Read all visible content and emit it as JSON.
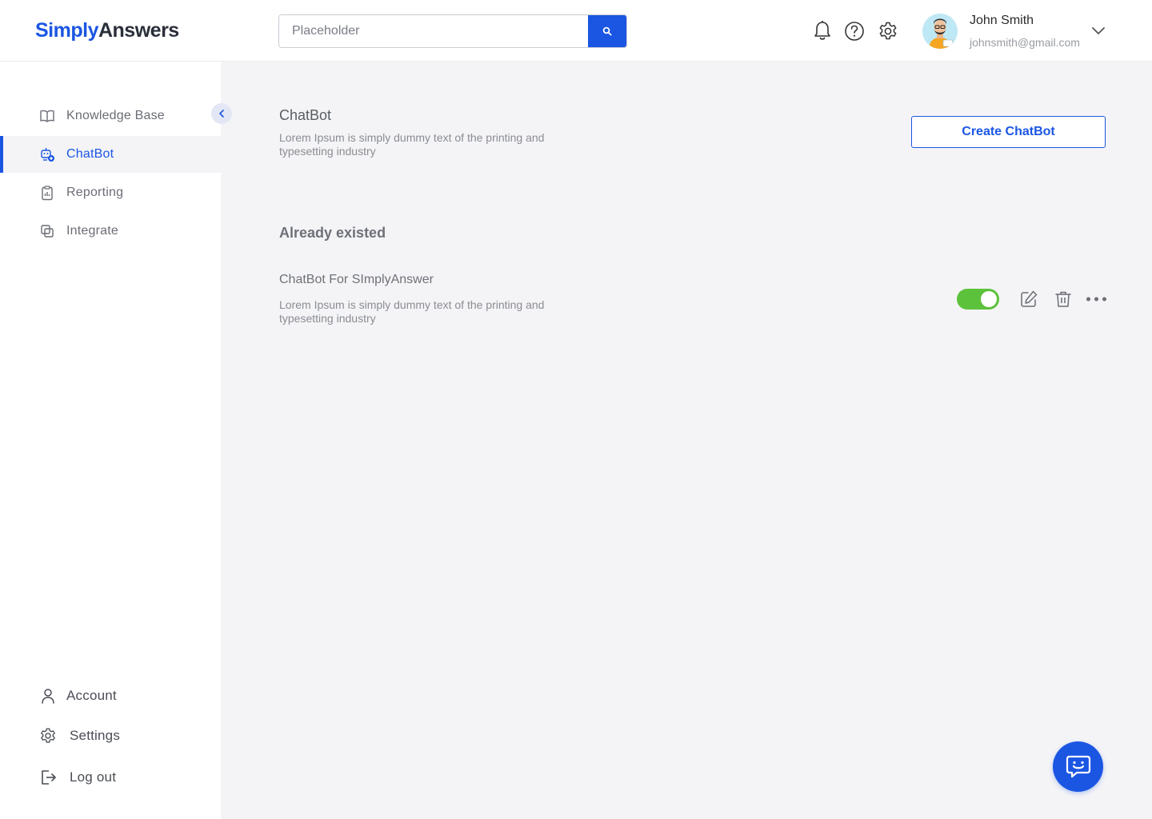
{
  "header": {
    "logo_part1": "Simply",
    "logo_part2": "Answers",
    "search_placeholder": "Placeholder",
    "user": {
      "name": "John Smith",
      "email": "johnsmith@gmail.com"
    }
  },
  "sidebar": {
    "items": [
      {
        "label": "Knowledge Base",
        "icon": "book-icon",
        "active": false
      },
      {
        "label": "ChatBot",
        "icon": "chatbot-icon",
        "active": true
      },
      {
        "label": "Reporting",
        "icon": "clipboard-icon",
        "active": false
      },
      {
        "label": "Integrate",
        "icon": "layers-icon",
        "active": false
      }
    ],
    "bottom": [
      {
        "label": "Account",
        "icon": "user-icon"
      },
      {
        "label": "Settings",
        "icon": "gear-icon"
      },
      {
        "label": "Log out",
        "icon": "logout-icon"
      }
    ]
  },
  "main": {
    "title": "ChatBot",
    "description": "Lorem Ipsum is simply dummy text of the printing and typesetting industry",
    "create_button": "Create ChatBot",
    "existed_title": "Already existed",
    "bots": [
      {
        "name": "ChatBot For SImplyAnswer",
        "description": "Lorem Ipsum is simply dummy text of the printing and typesetting industry",
        "enabled": true
      }
    ]
  },
  "colors": {
    "accent": "#1b56e3",
    "toggle_on": "#5cc13b"
  }
}
